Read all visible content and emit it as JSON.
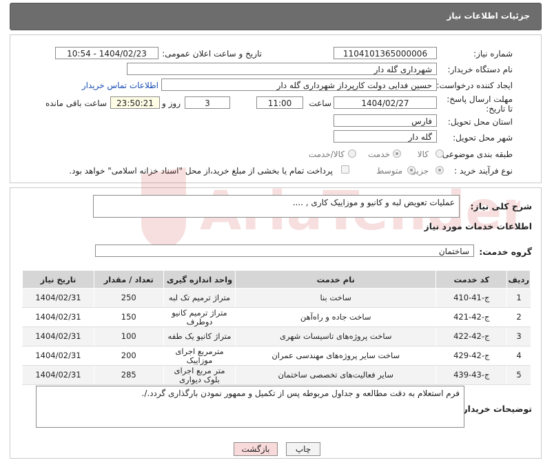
{
  "header": {
    "title": "جزئیات اطلاعات نیاز"
  },
  "form": {
    "need_number_label": "شماره نیاز:",
    "need_number": "1104101365000006",
    "announce_label": "تاریخ و ساعت اعلان عمومی:",
    "announce_value": "1404/02/23 - 10:54",
    "buyer_org_label": "نام دستگاه خریدار:",
    "buyer_org": "شهرداری گله دار",
    "requester_label": "ایجاد کننده درخواست:",
    "requester": "حسین فدایی دولت کارپرداز شهرداری گله دار",
    "contact_link": "اطلاعات تماس خریدار",
    "deadline_label": "مهلت ارسال پاسخ: تا تاریخ:",
    "deadline_date": "1404/02/27",
    "time_label": "ساعت",
    "deadline_time": "11:00",
    "days_value": "3",
    "days_label": "روز و",
    "remaining_time": "23:50:21",
    "remaining_label": "ساعت باقی مانده",
    "province_label": "استان محل تحویل:",
    "province": "فارس",
    "city_label": "شهر محل تحویل:",
    "city": "گله دار",
    "category_label": "طبقه بندی موضوعی:",
    "category_options": [
      "کالا",
      "خدمت",
      "کالا/خدمت"
    ],
    "category_selected": "خدمت",
    "process_label": "نوع فرآیند خرید :",
    "process_options": [
      "جزیی",
      "متوسط"
    ],
    "process_selected": "جزیی",
    "payment_note": "پرداخت تمام یا بخشی از مبلغ خرید،از محل \"اسناد خزانه اسلامی\" خواهد بود."
  },
  "summary": {
    "label": "شرح کلی نیاز:",
    "text": "عملیات تعویض لبه و کانیو و موزاییک کاری , ...."
  },
  "services": {
    "section_title": "اطلاعات خدمات مورد نیاز",
    "group_label": "گروه خدمت:",
    "group_value": "ساختمان",
    "columns": [
      "ردیف",
      "کد خدمت",
      "نام خدمت",
      "واحد اندازه گیری",
      "تعداد / مقدار",
      "تاریخ نیاز"
    ],
    "rows": [
      [
        "1",
        "ج-41-410",
        "ساخت بنا",
        "متراژ ترمیم تک لبه",
        "250",
        "1404/02/31"
      ],
      [
        "2",
        "ج-42-421",
        "ساخت جاده و راه‌آهن",
        "متراژ ترمیم کانیو دوطرف",
        "150",
        "1404/02/31"
      ],
      [
        "3",
        "ج-42-422",
        "ساخت پروژه‌های تاسیسات شهری",
        "متراژ کانیو یک طفه",
        "100",
        "1404/02/31"
      ],
      [
        "4",
        "ج-42-429",
        "ساخت سایر پروژه‌های مهندسی عمران",
        "مترمربع اجرای موزاییک",
        "200",
        "1404/02/31"
      ],
      [
        "5",
        "ج-43-439",
        "سایر فعالیت‌های تخصصی ساختمان",
        "متر مربع اجرای بلوک دیواری",
        "285",
        "1404/02/31"
      ]
    ]
  },
  "buyer_notes": {
    "label": "توضیحات خریدار:",
    "text": "فرم استعلام به دقت مطالعه و جداول مربوطه پس از تکمیل و ممهور نمودن بارگذاری گردد./."
  },
  "buttons": {
    "print": "چاپ",
    "back": "بازگشت"
  },
  "watermark": {
    "text": "AriaTender.neT"
  },
  "colors": {
    "titlebar": "#6d6d6d",
    "link": "#1a4fb5",
    "back_button_bg": "#f9dada",
    "watermark": "#d04040"
  }
}
